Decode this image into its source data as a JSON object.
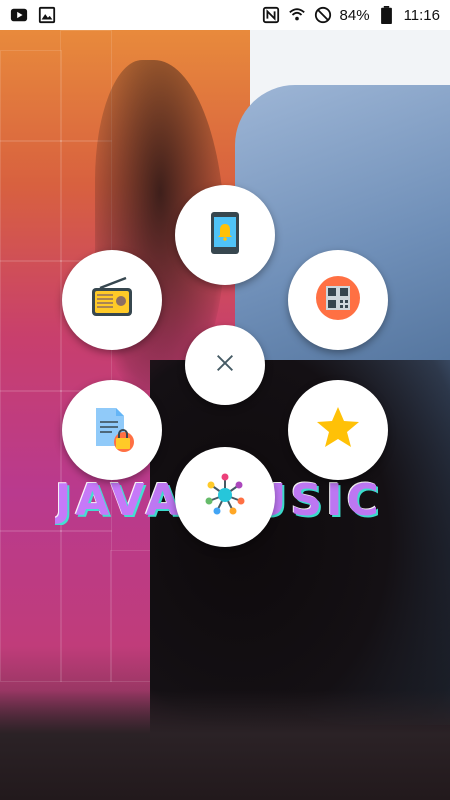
{
  "status_bar": {
    "battery": "84%",
    "time": "11:16",
    "icons_left": [
      "youtube-icon",
      "image-icon"
    ],
    "icons_right": [
      "nfc-icon",
      "wifi-icon",
      "do-not-disturb-icon",
      "battery-icon"
    ]
  },
  "background": {
    "watermark_text": "JAVA MUSIC",
    "accent_left": "#c83f6d",
    "accent_right": "#6f8fb8"
  },
  "radial_menu": {
    "items": [
      {
        "icon": "phone-notification-icon"
      },
      {
        "icon": "radio-icon"
      },
      {
        "icon": "qr-code-icon"
      },
      {
        "icon": "locked-document-icon"
      },
      {
        "icon": "star-icon"
      },
      {
        "icon": "network-hub-icon"
      }
    ],
    "close_icon": "close-icon"
  }
}
